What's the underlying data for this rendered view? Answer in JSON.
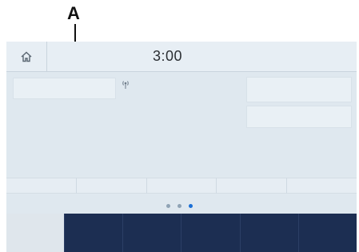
{
  "callout": {
    "label": "A"
  },
  "status_bar": {
    "time": "3:00",
    "home_icon": "home-icon"
  },
  "source": {
    "signal_icon": "radio-signal-icon"
  },
  "page_indicator": {
    "count": 3,
    "active_index": 2,
    "active_color": "#1b6fd6"
  },
  "presets": {
    "count": 5
  },
  "bottom_bar": {
    "tab_count": 6,
    "selected_index": 0,
    "color": "#1c2e52"
  }
}
